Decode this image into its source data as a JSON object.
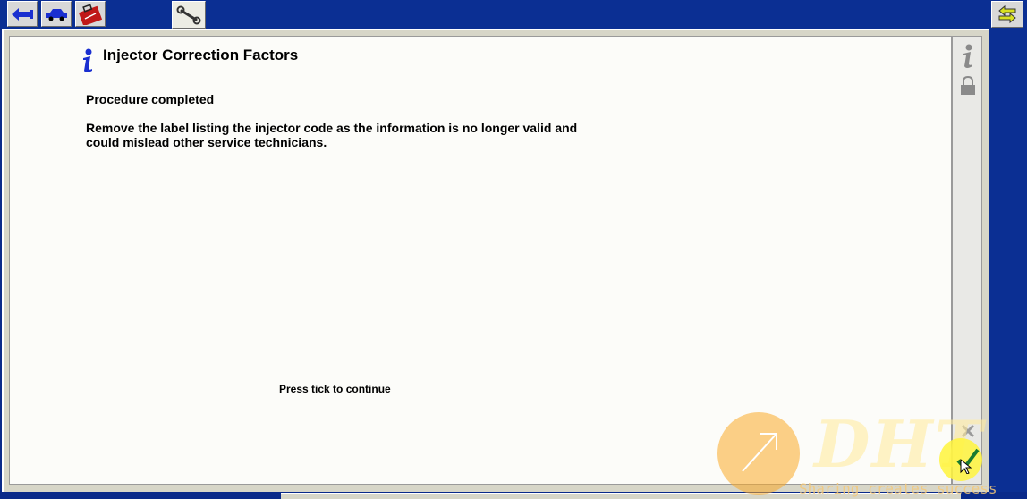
{
  "toolbar": {
    "buttons": [
      {
        "icon": "connect-arrow-icon"
      },
      {
        "icon": "vehicle-icon"
      },
      {
        "icon": "toolbox-icon"
      },
      {
        "icon": "wrench-icon",
        "active": true
      }
    ],
    "right_button_icon": "swap-arrows-icon"
  },
  "content": {
    "title": "Injector Correction Factors",
    "status": "Procedure completed",
    "message_line1": "Remove the label listing the injector code as the information is no longer valid and",
    "message_line2": "could mislead other service technicians.",
    "hint": "Press tick to continue"
  },
  "side_panel": {
    "icons": [
      "info-icon",
      "lock-icon",
      "cancel-icon",
      "tick-icon"
    ]
  },
  "watermark": {
    "brand": "DHT",
    "slogan": "Sharing creates success"
  },
  "colors": {
    "frame_blue": "#0b2f93",
    "panel_gray": "#d7d6c8",
    "content_bg": "#fcfcf9",
    "info_blue": "#1a2fd0"
  }
}
